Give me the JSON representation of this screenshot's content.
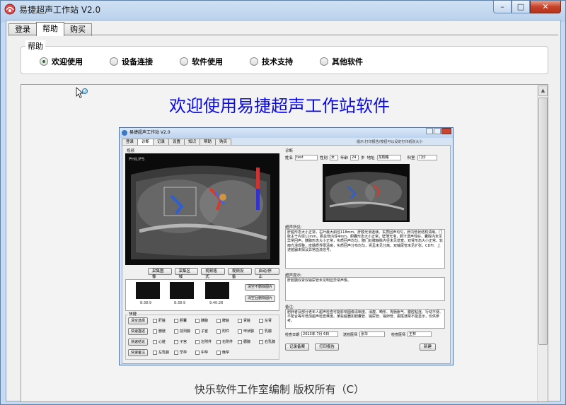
{
  "window": {
    "title": "易捷超声工作站 V2.0",
    "buttons": {
      "minimize": "–",
      "maximize": "□",
      "close": "✕"
    }
  },
  "tabs": [
    {
      "label": "登录",
      "active": false
    },
    {
      "label": "帮助",
      "active": true
    },
    {
      "label": "购买",
      "active": false
    }
  ],
  "help_group": {
    "label": "帮助",
    "options": [
      {
        "label": "欢迎使用",
        "checked": true
      },
      {
        "label": "设备连接",
        "checked": false
      },
      {
        "label": "软件使用",
        "checked": false
      },
      {
        "label": "技术支持",
        "checked": false
      },
      {
        "label": "其他软件",
        "checked": false
      }
    ]
  },
  "content": {
    "headline": "欢迎使用易捷超声工作站软件",
    "footer": "快乐软件工作室编制    版权所有（C）",
    "screenshot": {
      "title": "易捷超声工作站 V2.0",
      "note": "提示:打印报告/按钮可以设定打印纸张大小",
      "tabs": [
        "登录",
        "诊断",
        "记录",
        "设置",
        "知识",
        "帮助",
        "购买"
      ],
      "active_tab": "诊断",
      "video_label": "视频",
      "capture_buttons": [
        "采集图像",
        "采集区域",
        "视频格式",
        "视频设备",
        "启动/停止"
      ],
      "thumb_captions": [
        "8:38:9",
        "8:38:9",
        "9:40:28"
      ],
      "thumb_buttons": [
        "清空不删除图片",
        "清空且删除图片"
      ],
      "quick_label": "快捷",
      "quick_buttons": [
        "清空选择",
        "快速描述",
        "快速结论",
        "快速备注"
      ],
      "quick_checks": [
        "肝脏",
        "胆囊",
        "胰腺",
        "脾脏",
        "肾脏",
        "左肾",
        "膀胱",
        "前列腺",
        "子宫",
        "附件",
        "甲状腺",
        "乳腺",
        "心脏",
        "子宫",
        "左附件",
        "右附件",
        "腮腺",
        "右乳腺",
        "左乳腺",
        "早孕",
        "中孕",
        "晚孕"
      ],
      "diagnosis_label": "诊断",
      "patient": {
        "name_label": "姓名",
        "name": "test",
        "sex_label": "性别",
        "sex": "女",
        "age_label": "年龄",
        "age": "24",
        "age_unit": "岁",
        "address_label": "地址",
        "address": "龙翔路",
        "dept_label": "科室",
        "dept": "门诊"
      },
      "findings_label": "超声所见:",
      "findings_text": "肝脏形态大小正常，右叶最大斜径118mm，肝膜光滑连续。实质回声均匀，肝内管状结构清晰。门脉主干内径11mm。胆总管内径4mm。胆囊形态大小正常，壁薄光滑，胆汁透声性好。囊腔内未见异常回声。胰腺形态大小正常，实质回声均匀，胰门处脾静脉内径未见增宽。双肾形态大小正常，轮廓光滑规整，皮髓质界限清晰，实质回声分布均匀，肾盂未见分离。双输尿管未见扩张。CDFI：上述脏器未探及异常血流信号。",
      "hint_label": "超声提示:",
      "hint_text": "肝胆胰双肾双输尿管未见明显异常声像。",
      "remark_label": "备注:",
      "remark_text": "肥胖者及部分老年人超声检查可能影响图像清晰度。消瘦、畸形、胃肠胀气、腹腔粘连、行动不便、不配合等可增加超声检查难度。某些脏器如胆囊管、输尿管、输卵管、阑尾通常不能显示，仅供参考。",
      "check_date_label": "检查日期",
      "check_date": "2013年 7月 6日",
      "send_doctor_label": "送检医师",
      "send_doctor": "张华",
      "check_doctor_label": "检查医师",
      "check_doctor": "王林",
      "action_buttons": [
        "记录备案",
        "打印报告",
        "新建"
      ]
    }
  },
  "colors": {
    "headline": "#0a0ae6",
    "accent": "#3978c2",
    "close": "#c7432a"
  },
  "icons": [
    "app-icon",
    "minimize-icon",
    "maximize-icon",
    "close-icon",
    "help-cursor-icon"
  ]
}
